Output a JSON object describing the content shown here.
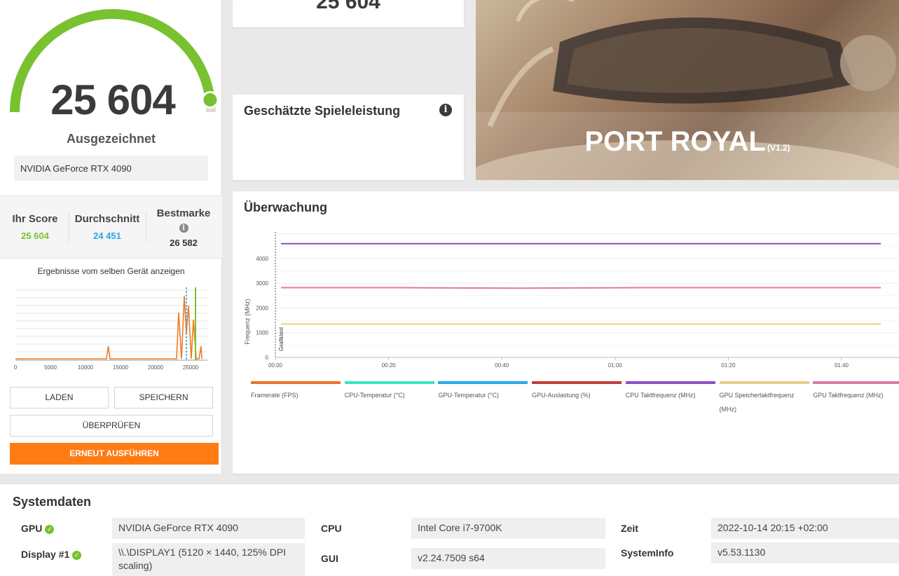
{
  "left": {
    "score": "25 604",
    "rating": "Ausgezeichnet",
    "gpu": "NVIDIA GeForce RTX 4090",
    "gauge_fraction": 0.96,
    "stats": {
      "your_score_label": "Ihr Score",
      "your_score_value": "25 604",
      "average_label": "Durchschnitt",
      "average_value": "24 451",
      "best_label": "Bestmarke",
      "best_value": "26 582"
    },
    "same_device_text": "Ergebnisse vom selben Gerät anzeigen",
    "histogram": {
      "x_ticks": [
        "0",
        "5000",
        "10000",
        "15000",
        "20000",
        "25000"
      ]
    },
    "buttons": {
      "load": "LADEN",
      "save": "SPEICHERN",
      "verify": "ÜBERPRÜFEN",
      "rerun": "ERNEUT AUSFÜHREN"
    }
  },
  "top_card": {
    "score": "25 604"
  },
  "game_card": {
    "title": "Geschätzte Spieleleistung"
  },
  "banner": {
    "title": "PORT ROYAL",
    "version": "(V1.2)"
  },
  "monitoring": {
    "title": "Überwachung",
    "y_axis_label": "Frequenz (MHz)",
    "section_label": "Grafiktest",
    "y_ticks": [
      "0",
      "1000",
      "2000",
      "3000",
      "4000"
    ],
    "x_ticks": [
      "00:00",
      "00:20",
      "00:40",
      "01:00",
      "01:20",
      "01:40"
    ],
    "legend": [
      {
        "label": "Framerate (FPS)",
        "color": "#e8742a"
      },
      {
        "label": "CPU-Temperatur (°C)",
        "color": "#38e6c4"
      },
      {
        "label": "GPU-Temperatur (°C)",
        "color": "#29a9e8"
      },
      {
        "label": "GPU-Auslastung (%)",
        "color": "#c23b3b"
      },
      {
        "label": "CPU Taktfrequenz (MHz)",
        "color": "#8d4fc4"
      },
      {
        "label": "GPU Speichertaktfrequenz (MHz)",
        "color": "#e7cd87"
      },
      {
        "label": "GPU Taktfrequenz (MHz)",
        "color": "#e276a5"
      }
    ]
  },
  "chart_data": {
    "type": "line",
    "title": "",
    "xlabel": "",
    "ylabel": "Frequenz (MHz)",
    "ylim": [
      0,
      5000
    ],
    "x": [
      "00:00",
      "00:20",
      "00:40",
      "01:00",
      "01:20",
      "01:40"
    ],
    "series": [
      {
        "name": "CPU Taktfrequenz (MHz)",
        "values": [
          4600,
          4600,
          4600,
          4600,
          4600,
          4600
        ]
      },
      {
        "name": "GPU Taktfrequenz (MHz)",
        "values": [
          2820,
          2820,
          2800,
          2820,
          2820,
          2820
        ]
      },
      {
        "name": "GPU Speichertaktfrequenz (MHz)",
        "values": [
          1350,
          1350,
          1350,
          1350,
          1350,
          1350
        ]
      }
    ]
  },
  "system": {
    "title": "Systemdaten",
    "rows": {
      "gpu_label": "GPU",
      "gpu_value": "NVIDIA GeForce RTX 4090",
      "display_label": "Display #1",
      "display_value": "\\\\.\\DISPLAY1 (5120 × 1440, 125% DPI scaling)",
      "cpu_label": "CPU",
      "cpu_value": "Intel Core i7-9700K",
      "gui_label": "GUI",
      "gui_value": "v2.24.7509 s64",
      "time_label": "Zeit",
      "time_value": "2022-10-14 20:15 +02:00",
      "sysinfo_label": "SystemInfo",
      "sysinfo_value": "v5.53.1130"
    },
    "check_symbol": "✓"
  },
  "colors": {
    "accent_green": "#78c22f",
    "accent_blue": "#28a6e0",
    "accent_orange": "#ff7b14"
  }
}
